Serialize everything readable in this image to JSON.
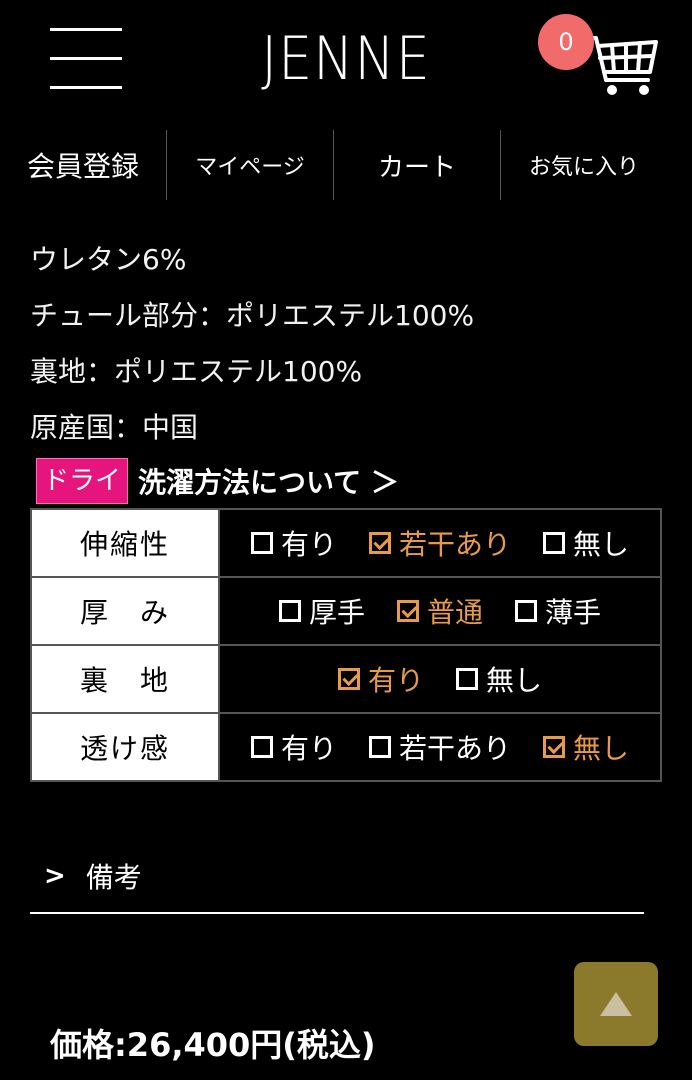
{
  "header": {
    "logo": "JENNE",
    "cart_count": "0"
  },
  "nav": [
    {
      "label": "会員登録"
    },
    {
      "label": "マイページ"
    },
    {
      "label": "カート"
    },
    {
      "label": "お気に入り"
    }
  ],
  "materials": [
    "ウレタン6%",
    "チュール部分：ポリエステル100%",
    "裏地：ポリエステル100%",
    "原産国：中国"
  ],
  "care": {
    "badge": "ドライ",
    "link": "洗濯方法について ＞"
  },
  "spec_table": [
    {
      "label": "伸縮性",
      "options": [
        {
          "text": "有り",
          "checked": false
        },
        {
          "text": "若干あり",
          "checked": true
        },
        {
          "text": "無し",
          "checked": false
        }
      ]
    },
    {
      "label": "厚　み",
      "options": [
        {
          "text": "厚手",
          "checked": false
        },
        {
          "text": "普通",
          "checked": true
        },
        {
          "text": "薄手",
          "checked": false
        }
      ]
    },
    {
      "label": "裏　地",
      "options": [
        {
          "text": "有り",
          "checked": true
        },
        {
          "text": "無し",
          "checked": false
        }
      ]
    },
    {
      "label": "透け感",
      "options": [
        {
          "text": "有り",
          "checked": false
        },
        {
          "text": "若干あり",
          "checked": false
        },
        {
          "text": "無し",
          "checked": true
        }
      ]
    }
  ],
  "remarks": {
    "chevron": ">",
    "label": "備考"
  },
  "price": "価格:26,400円(税込)",
  "colors": {
    "background": "#000000",
    "checked": "#e79b4a",
    "badge": "#f26b6b",
    "dry_badge": "#e6157d",
    "to_top": "#8c7a2c"
  },
  "icons": {
    "menu": "hamburger-icon",
    "cart": "shopping-cart-icon",
    "to_top": "triangle-up-icon"
  }
}
